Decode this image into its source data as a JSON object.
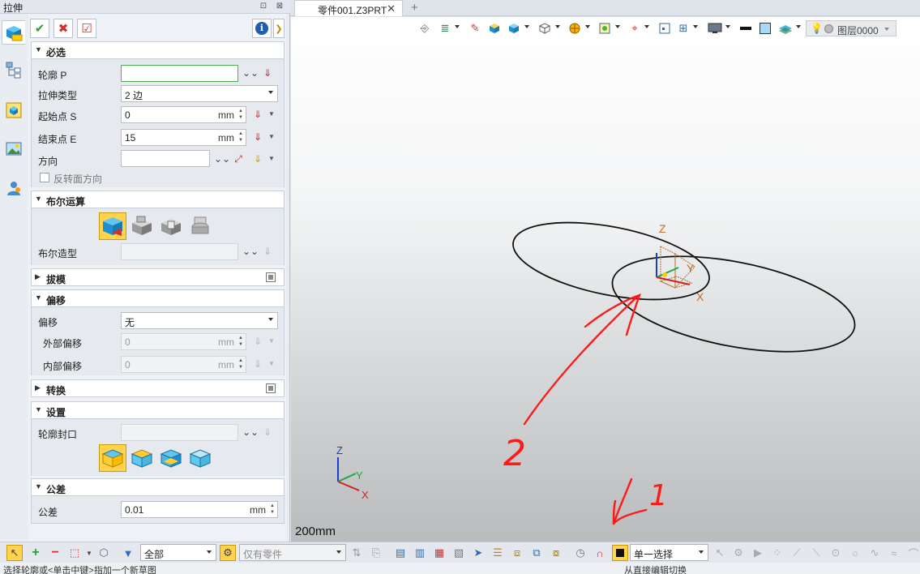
{
  "panel": {
    "title": "拉伸",
    "pin_glyph": "⊡",
    "close_glyph": "⊠"
  },
  "actions": {
    "ok_glyph": "✔",
    "cancel_glyph": "✖",
    "apply_glyph": "☑",
    "info_glyph": "i"
  },
  "sections": {
    "required": {
      "title": "必选",
      "profile_label": "轮廓 P",
      "profile_value": "",
      "type_label": "拉伸类型",
      "type_value": "2 边",
      "start_label": "起始点 S",
      "start_value": "0",
      "start_unit": "mm",
      "end_label": "结束点 E",
      "end_value": "15",
      "end_unit": "mm",
      "direction_label": "方向",
      "direction_value": "",
      "reverse_label": "反转面方向"
    },
    "boolean": {
      "title": "布尔运算",
      "shape_label": "布尔造型",
      "shape_value": ""
    },
    "draft": {
      "title": "拔模"
    },
    "offset": {
      "title": "偏移",
      "offset_label": "偏移",
      "offset_value": "无",
      "outer_label": "外部偏移",
      "outer_value": "0",
      "outer_unit": "mm",
      "inner_label": "内部偏移",
      "inner_value": "0",
      "inner_unit": "mm"
    },
    "transform": {
      "title": "转换"
    },
    "settings": {
      "title": "设置",
      "cap_label": "轮廓封口",
      "cap_value": ""
    },
    "tolerance": {
      "title": "公差",
      "tol_label": "公差",
      "tol_value": "0.01",
      "tol_unit": "mm"
    }
  },
  "tabs": {
    "doc_tab": "零件001.Z3PRT",
    "close_glyph": "✕",
    "add_glyph": "+"
  },
  "view_toolbar": {
    "layer_label": "图层0000"
  },
  "viewport": {
    "scale_label": "200mm",
    "triad_labels": {
      "z": "Z",
      "y": "Y",
      "x": "X"
    },
    "annotation_1": "1",
    "annotation_2": "2"
  },
  "bottom_bar": {
    "filter_value": "全部",
    "part_filter_value": "仅有零件",
    "select_mode_value": "单一选择"
  },
  "status_bar": {
    "message": "选择轮廓或<单击中键>指加一个新草图",
    "right_message": "从直接编辑切换"
  },
  "colors": {
    "accent_yellow": "#ffd34d",
    "annotation_red": "#ff1a1a",
    "ok_green": "#2e9e34",
    "cancel_red": "#d32f2f"
  }
}
